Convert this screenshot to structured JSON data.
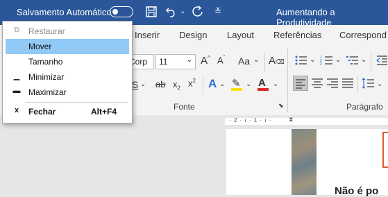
{
  "titlebar": {
    "autosave_label": "Salvamento Automático",
    "doc_title": "Aumentando a Produtividade"
  },
  "tabs": [
    "Inserir",
    "Design",
    "Layout",
    "Referências",
    "Correspond"
  ],
  "ribbon": {
    "font_name": "Corp",
    "font_size": "11",
    "font_group": "Fonte",
    "paragraph_group": "Parágrafo",
    "font_color": "#d92b2b",
    "highlight_color": "#f5e400"
  },
  "system_menu": {
    "items": [
      {
        "label": "Restaurar",
        "icon": "restore-icon",
        "enabled": false
      },
      {
        "label": "Mover",
        "icon": "",
        "enabled": true,
        "highlighted": true
      },
      {
        "label": "Tamanho",
        "icon": "",
        "enabled": true
      },
      {
        "label": "Minimizar",
        "icon": "minimize-icon",
        "enabled": true
      },
      {
        "label": "Maximizar",
        "icon": "maximize-icon",
        "enabled": true
      },
      {
        "label": "Fechar",
        "icon": "close-icon",
        "enabled": true,
        "shortcut": "Alt+F4"
      }
    ]
  },
  "document": {
    "ruler_marks": "· 2 · ı · 1 · ı ·",
    "visible_text": "Não é po"
  }
}
